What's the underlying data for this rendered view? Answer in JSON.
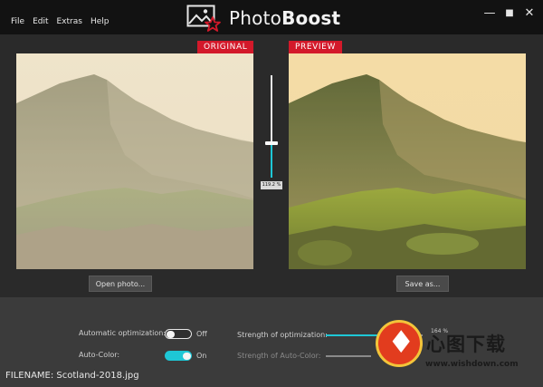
{
  "menu": [
    "File",
    "Edit",
    "Extras",
    "Help"
  ],
  "app": {
    "name_prefix": "Photo",
    "name_suffix": "Boost"
  },
  "window": {
    "minimize": "—",
    "maximize": "■",
    "close": "✕"
  },
  "compare": {
    "original_label": "ORIGINAL",
    "preview_label": "PREVIEW",
    "open_button": "Open photo...",
    "save_button": "Save as...",
    "slider_value": "119.2 %"
  },
  "settings": {
    "auto_opt_label": "Automatic optimization:",
    "auto_opt_state": "Off",
    "auto_color_label": "Auto-Color:",
    "auto_color_state": "On",
    "strength_label": "Strength of optimization:",
    "strength_value": "164 %",
    "autocolor_strength_label": "Strength of Auto-Color:"
  },
  "status": {
    "filename": "FILENAME: Scotland-2018.jpg"
  },
  "watermark": {
    "glyph": "♦",
    "text": "心图下载",
    "url": "www.wishdown.com"
  },
  "colors": {
    "accent": "#1ec7d6",
    "tag_red": "#d3192a"
  }
}
